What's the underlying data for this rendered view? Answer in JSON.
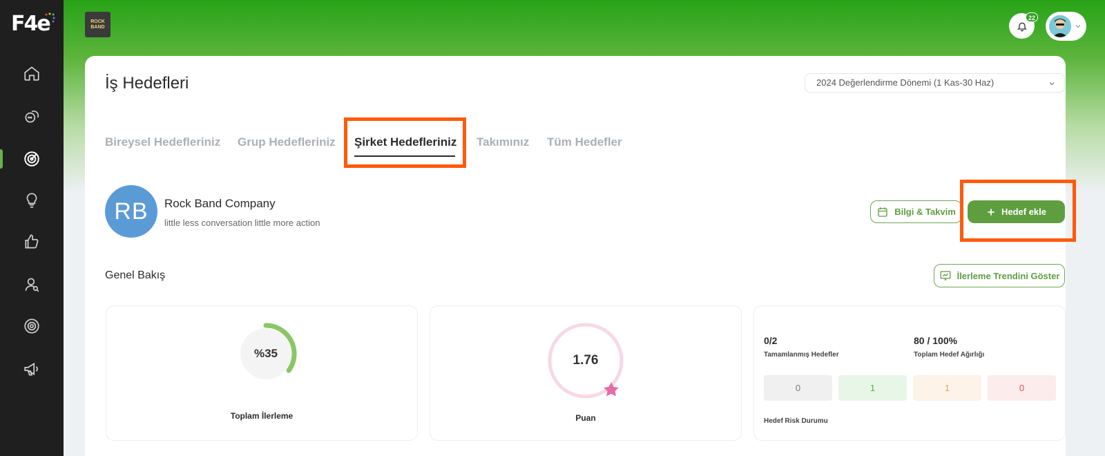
{
  "app": {
    "logo_text": "F4e"
  },
  "header": {
    "company_thumb_text": "ROCK BAND",
    "notifications_count": "22"
  },
  "page": {
    "title": "İş Hedefleri"
  },
  "period": {
    "selected": "2024 Değerlendirme Dönemi (1 Kas-30 Haz)"
  },
  "tabs": [
    {
      "label": "Bireysel Hedefleriniz"
    },
    {
      "label": "Grup Hedefleriniz"
    },
    {
      "label": "Şirket Hedefleriniz"
    },
    {
      "label": "Takımınız"
    },
    {
      "label": "Tüm Hedefler"
    }
  ],
  "company": {
    "initials": "RB",
    "name": "Rock Band Company",
    "motto": "little less conversation little more action"
  },
  "actions": {
    "info_calendar": "Bilgi & Takvim",
    "add_goal": "Hedef ekle",
    "show_trend": "İlerleme Trendini Göster"
  },
  "overview": {
    "title": "Genel Bakış",
    "progress": {
      "value_text": "%35",
      "fraction": 0.35,
      "label": "Toplam İlerleme"
    },
    "score": {
      "value_text": "1.76",
      "label": "Puan"
    },
    "completed": {
      "value": "0/2",
      "label": "Tamamlanmış Hedefler"
    },
    "weight": {
      "value": "80 / 100%",
      "label": "Toplam Hedef Ağırlığı"
    },
    "risk": {
      "label": "Hedef Risk Durumu",
      "values": [
        "0",
        "1",
        "1",
        "0"
      ],
      "colors": [
        "#f0f0f0",
        "#e8f6e8",
        "#fdf3e8",
        "#fdecec"
      ],
      "text_colors": [
        "#777777",
        "#4caf50",
        "#f0a050",
        "#e05050"
      ]
    }
  },
  "colors": {
    "accent": "#5f9e3f",
    "highlight": "#ff5a0a",
    "sidebar": "#1f1f1f"
  }
}
